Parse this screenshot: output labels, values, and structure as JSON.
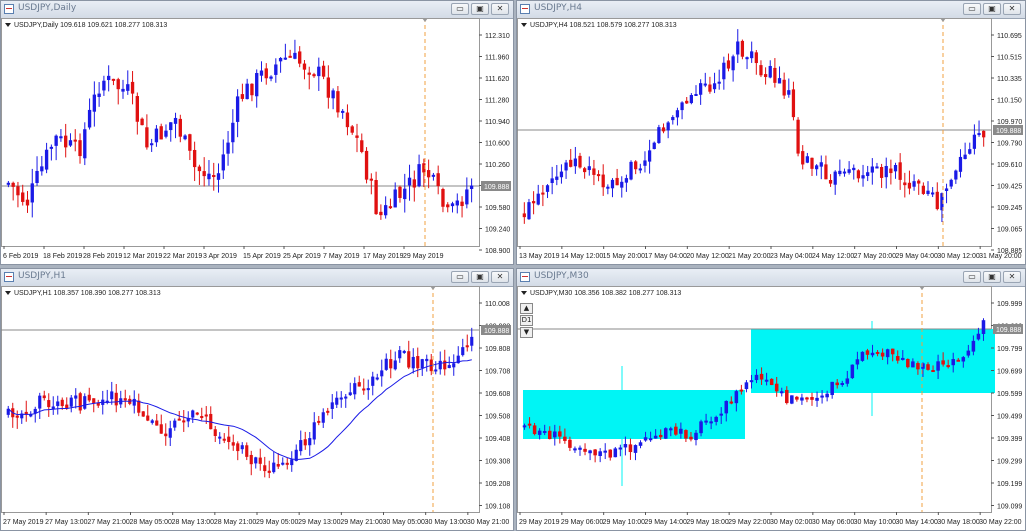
{
  "windows": [
    {
      "id": "daily",
      "title": "USDJPY,Daily",
      "info": "USDJPY,Daily  109.618 109.621 108.277 108.313",
      "price_labels": [
        "112.310",
        "111.960",
        "111.620",
        "111.280",
        "110.940",
        "110.600",
        "110.260",
        "109.920",
        "109.580",
        "109.240",
        "108.900"
      ],
      "current_price": "109.888",
      "time_labels": [
        "6 Feb 2019",
        "18 Feb 2019",
        "28 Feb 2019",
        "12 Mar 2019",
        "22 Mar 2019",
        "3 Apr 2019",
        "15 Apr 2019",
        "25 Apr 2019",
        "7 May 2019",
        "17 May 2019",
        "29 May 2019"
      ]
    },
    {
      "id": "h4",
      "title": "USDJPY,H4",
      "info": "USDJPY,H4  108.521 108.579 108.277 108.313",
      "price_labels": [
        "110.695",
        "110.515",
        "110.335",
        "110.150",
        "109.970",
        "109.790",
        "109.610",
        "109.425",
        "109.245",
        "109.065",
        "108.885"
      ],
      "current_price": "109.888",
      "time_labels": [
        "13 May 2019",
        "14 May 12:00",
        "15 May 20:00",
        "17 May 04:00",
        "20 May 12:00",
        "21 May 20:00",
        "23 May 04:00",
        "24 May 12:00",
        "27 May 20:00",
        "29 May 04:00",
        "30 May 12:00",
        "31 May 20:00"
      ]
    },
    {
      "id": "h1",
      "title": "USDJPY,H1",
      "info": "USDJPY,H1  108.357 108.390 108.277 108.313",
      "price_labels": [
        "110.008",
        "109.908",
        "109.808",
        "109.708",
        "109.608",
        "109.508",
        "109.408",
        "109.308",
        "109.208",
        "109.108"
      ],
      "current_price": "109.888",
      "time_labels": [
        "27 May 2019",
        "27 May 13:00",
        "27 May 21:00",
        "28 May 05:00",
        "28 May 13:00",
        "28 May 21:00",
        "29 May 05:00",
        "29 May 13:00",
        "29 May 21:00",
        "30 May 05:00",
        "30 May 13:00",
        "30 May 21:00"
      ]
    },
    {
      "id": "m30",
      "title": "USDJPY,M30",
      "info": "USDJPY,M30  108.356 108.382 108.277 108.313",
      "price_labels": [
        "109.999",
        "109.899",
        "109.799",
        "109.699",
        "109.599",
        "109.499",
        "109.399",
        "109.299",
        "109.199",
        "109.099"
      ],
      "current_price": "109.888",
      "time_labels": [
        "29 May 2019",
        "29 May 06:00",
        "29 May 10:00",
        "29 May 14:00",
        "29 May 18:00",
        "29 May 22:00",
        "30 May 02:00",
        "30 May 06:00",
        "30 May 10:00",
        "30 May 14:00",
        "30 May 18:00",
        "30 May 22:00"
      ],
      "stepper": {
        "up": "▲",
        "label": "D1",
        "down": "▼"
      }
    }
  ],
  "window_buttons": {
    "minimize": "▭",
    "maximize": "▣",
    "close": "✕"
  },
  "colors": {
    "bull": "#1a1ae6",
    "bear": "#e01010",
    "ma": "#1a1ae6",
    "box": "#00f5f5",
    "period_line": "#f0a040",
    "grid": "#888888"
  }
}
